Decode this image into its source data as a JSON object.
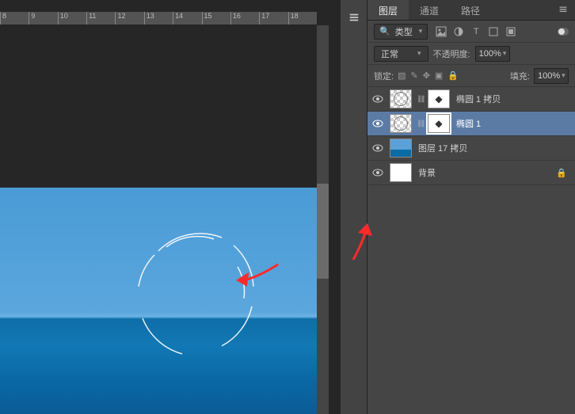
{
  "ruler": {
    "ticks": [
      "8",
      "9",
      "10",
      "11",
      "12",
      "13",
      "14",
      "15",
      "16",
      "17",
      "18"
    ]
  },
  "panel": {
    "tabs": {
      "layers": "图层",
      "channels": "通道",
      "paths": "路径"
    },
    "filter": {
      "label": "类型"
    },
    "blend": {
      "mode": "正常",
      "opacity_label": "不透明度:",
      "opacity_value": "100%"
    },
    "lock": {
      "label": "锁定:",
      "fill_label": "填充:",
      "fill_value": "100%"
    }
  },
  "layers": [
    {
      "name": "椭圆 1 拷贝",
      "type": "shape-mask"
    },
    {
      "name": "椭圆 1",
      "type": "shape-mask",
      "selected": true
    },
    {
      "name": "图层 17 拷贝",
      "type": "image"
    },
    {
      "name": "背景",
      "type": "bg",
      "locked": true
    }
  ]
}
